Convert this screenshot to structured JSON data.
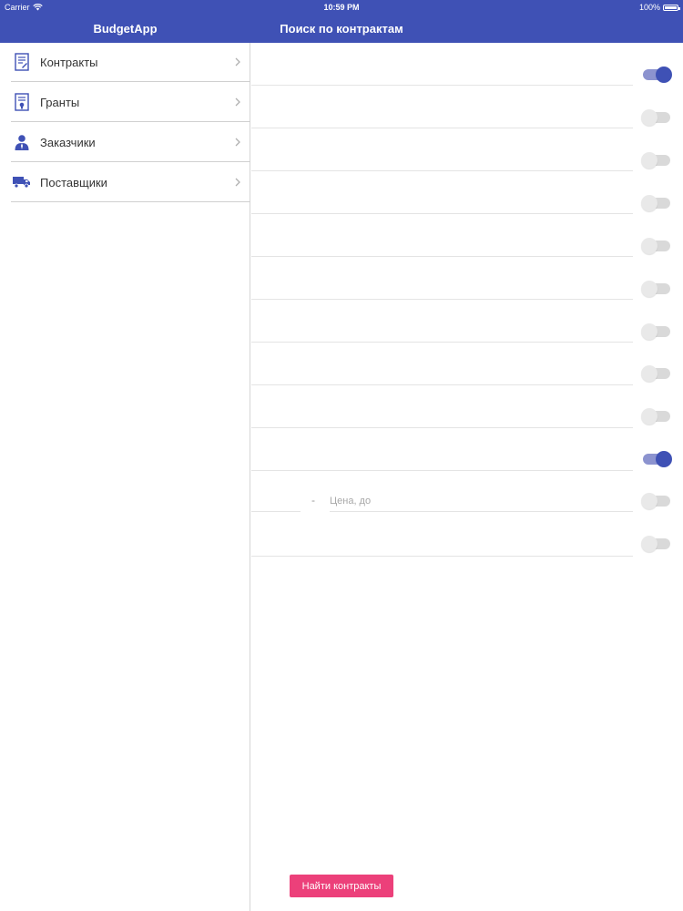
{
  "status_bar": {
    "carrier": "Carrier",
    "time": "10:59 PM",
    "battery": "100%"
  },
  "nav": {
    "left_title": "BudgetApp",
    "right_title": "Поиск по контрактам"
  },
  "sidebar": {
    "items": [
      {
        "label": "Контракты",
        "icon": "contract-document-icon"
      },
      {
        "label": "Гранты",
        "icon": "grant-certificate-icon"
      },
      {
        "label": "Заказчики",
        "icon": "customer-person-icon"
      },
      {
        "label": "Поставщики",
        "icon": "supplier-truck-icon"
      }
    ]
  },
  "search": {
    "toggles": [
      true,
      false,
      false,
      false,
      false,
      false,
      false,
      false,
      false,
      true,
      false,
      false
    ],
    "price_to_placeholder": "Цена, до",
    "price_separator": "-",
    "submit_label": "Найти контракты"
  },
  "colors": {
    "primary": "#3f51b5",
    "accent": "#ec407a",
    "toggle_track_on": "#8c93cf"
  }
}
